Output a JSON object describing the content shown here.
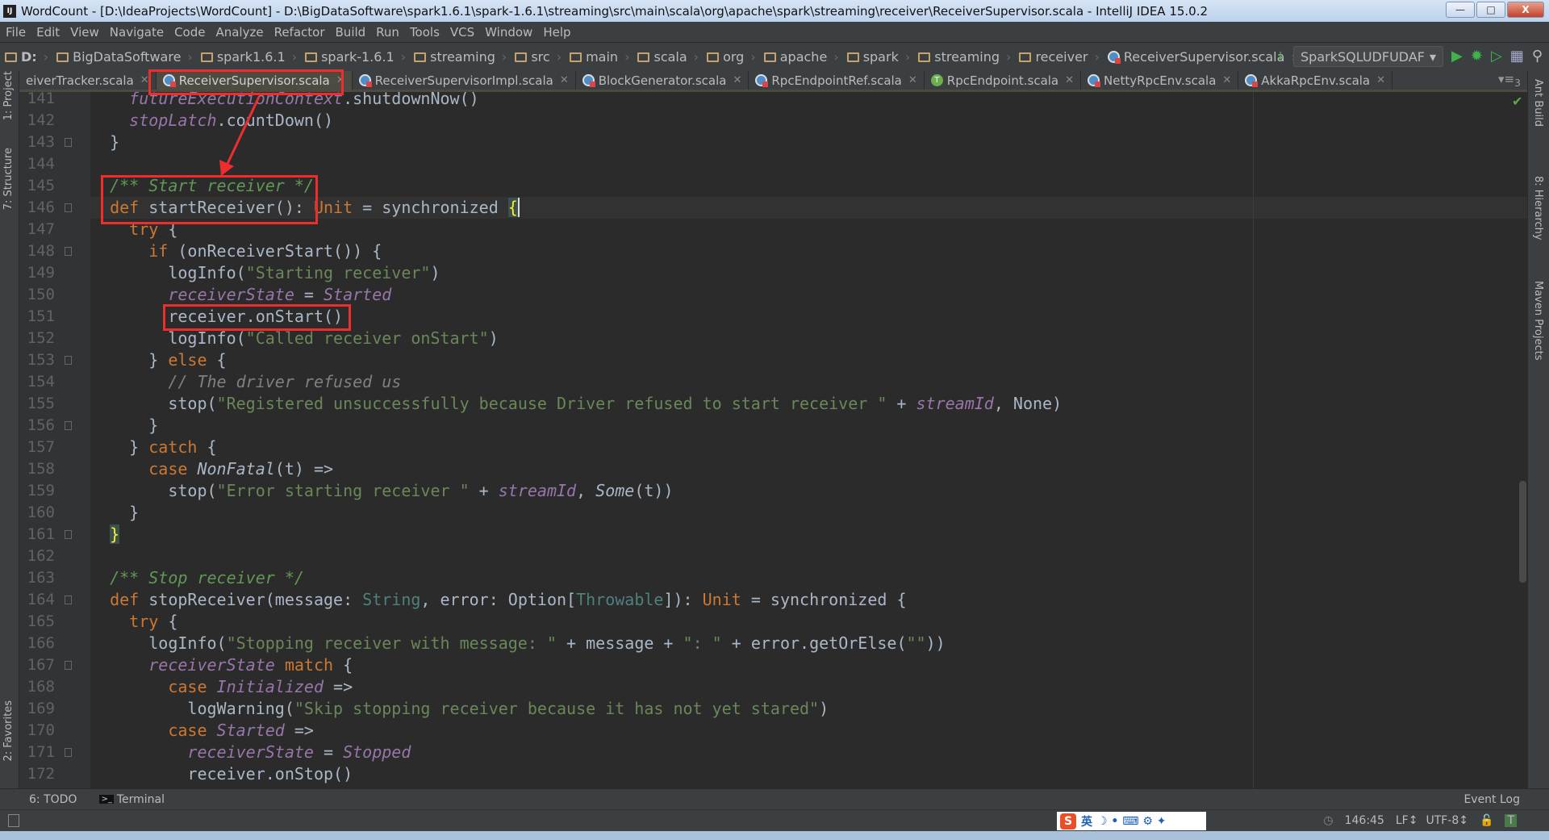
{
  "window": {
    "title": "WordCount - [D:\\IdeaProjects\\WordCount] - D:\\BigDataSoftware\\spark1.6.1\\spark-1.6.1\\streaming\\src\\main\\scala\\org\\apache\\spark\\streaming\\receiver\\ReceiverSupervisor.scala - IntelliJ IDEA 15.0.2",
    "app_icon": "IJ"
  },
  "menu": [
    "File",
    "Edit",
    "View",
    "Navigate",
    "Code",
    "Analyze",
    "Refactor",
    "Build",
    "Run",
    "Tools",
    "VCS",
    "Window",
    "Help"
  ],
  "breadcrumb": [
    "D:",
    "BigDataSoftware",
    "spark1.6.1",
    "spark-1.6.1",
    "streaming",
    "src",
    "main",
    "scala",
    "org",
    "apache",
    "spark",
    "streaming",
    "receiver"
  ],
  "breadcrumb_file": "ReceiverSupervisor.scala",
  "run_config": "SparkSQLUDFUDAF",
  "tabs": [
    {
      "label": "eiverTracker.scala",
      "icon": "scala-class-icon"
    },
    {
      "label": "ReceiverSupervisor.scala",
      "icon": "scala-class-icon",
      "active": true
    },
    {
      "label": "ReceiverSupervisorImpl.scala",
      "icon": "scala-class-icon"
    },
    {
      "label": "BlockGenerator.scala",
      "icon": "scala-class-icon"
    },
    {
      "label": "RpcEndpointRef.scala",
      "icon": "scala-class-icon"
    },
    {
      "label": "RpcEndpoint.scala",
      "icon": "trait-icon"
    },
    {
      "label": "NettyRpcEnv.scala",
      "icon": "scala-class-icon"
    },
    {
      "label": "AkkaRpcEnv.scala",
      "icon": "scala-class-icon"
    }
  ],
  "tab_overflow": "3",
  "left_tools": [
    "1: Project",
    "7: Structure",
    "2: Favorites"
  ],
  "right_tools": [
    "Ant Build",
    "8: Hierarchy",
    "Maven Projects"
  ],
  "current_line": 146,
  "code": [
    {
      "n": "141",
      "t": [
        [
          "pl",
          "    "
        ],
        [
          "fld",
          "futureExecutionContext"
        ],
        [
          "pl",
          ".shutdownNow()"
        ]
      ]
    },
    {
      "n": "142",
      "t": [
        [
          "pl",
          "    "
        ],
        [
          "fld",
          "stopLatch"
        ],
        [
          "pl",
          ".countDown()"
        ]
      ]
    },
    {
      "n": "143",
      "t": [
        [
          "pl",
          "  }"
        ]
      ],
      "fold": true
    },
    {
      "n": "144",
      "t": []
    },
    {
      "n": "145",
      "t": [
        [
          "pl",
          "  "
        ],
        [
          "doc",
          "/** Start receiver */"
        ]
      ]
    },
    {
      "n": "146",
      "t": [
        [
          "pl",
          "  "
        ],
        [
          "kw",
          "def"
        ],
        [
          "pl",
          " startReceiver(): "
        ],
        [
          "kw",
          "Unit"
        ],
        [
          "pl",
          " = synchronized "
        ],
        [
          "brace",
          "{"
        ]
      ],
      "fold": true
    },
    {
      "n": "147",
      "t": [
        [
          "pl",
          "    "
        ],
        [
          "kw",
          "try"
        ],
        [
          "pl",
          " {"
        ]
      ]
    },
    {
      "n": "148",
      "t": [
        [
          "pl",
          "      "
        ],
        [
          "kw",
          "if"
        ],
        [
          "pl",
          " (onReceiverStart()) {"
        ]
      ],
      "fold": true
    },
    {
      "n": "149",
      "t": [
        [
          "pl",
          "        logInfo("
        ],
        [
          "str",
          "\"Starting receiver\""
        ],
        [
          "pl",
          ")"
        ]
      ]
    },
    {
      "n": "150",
      "t": [
        [
          "pl",
          "        "
        ],
        [
          "fld",
          "receiverState"
        ],
        [
          "pl",
          " = "
        ],
        [
          "fld",
          "Started"
        ]
      ]
    },
    {
      "n": "151",
      "t": [
        [
          "pl",
          "        receiver.onStart()"
        ]
      ]
    },
    {
      "n": "152",
      "t": [
        [
          "pl",
          "        logInfo("
        ],
        [
          "str",
          "\"Called receiver onStart\""
        ],
        [
          "pl",
          ")"
        ]
      ]
    },
    {
      "n": "153",
      "t": [
        [
          "pl",
          "      } "
        ],
        [
          "kw",
          "else"
        ],
        [
          "pl",
          " {"
        ]
      ],
      "fold": true
    },
    {
      "n": "154",
      "t": [
        [
          "pl",
          "        "
        ],
        [
          "cmt",
          "// The driver refused us"
        ]
      ]
    },
    {
      "n": "155",
      "t": [
        [
          "pl",
          "        stop("
        ],
        [
          "str",
          "\"Registered unsuccessfully because Driver refused to start receiver \""
        ],
        [
          "pl",
          " + "
        ],
        [
          "fld",
          "streamId"
        ],
        [
          "pl",
          ", None)"
        ]
      ]
    },
    {
      "n": "156",
      "t": [
        [
          "pl",
          "      }"
        ]
      ],
      "fold": true
    },
    {
      "n": "157",
      "t": [
        [
          "pl",
          "    } "
        ],
        [
          "kw",
          "catch"
        ],
        [
          "pl",
          " {"
        ]
      ]
    },
    {
      "n": "158",
      "t": [
        [
          "pl",
          "      "
        ],
        [
          "kw",
          "case"
        ],
        [
          "pl",
          " "
        ],
        [
          "it",
          "NonFatal"
        ],
        [
          "pl",
          "(t) =>"
        ]
      ]
    },
    {
      "n": "159",
      "t": [
        [
          "pl",
          "        stop("
        ],
        [
          "str",
          "\"Error starting receiver \""
        ],
        [
          "pl",
          " + "
        ],
        [
          "fld",
          "streamId"
        ],
        [
          "pl",
          ", "
        ],
        [
          "it",
          "Some"
        ],
        [
          "pl",
          "(t))"
        ]
      ]
    },
    {
      "n": "160",
      "t": [
        [
          "pl",
          "    }"
        ]
      ]
    },
    {
      "n": "161",
      "t": [
        [
          "pl",
          "  "
        ],
        [
          "brace",
          "}"
        ]
      ],
      "fold": true
    },
    {
      "n": "162",
      "t": []
    },
    {
      "n": "163",
      "t": [
        [
          "pl",
          "  "
        ],
        [
          "doc",
          "/** Stop receiver */"
        ]
      ]
    },
    {
      "n": "164",
      "t": [
        [
          "pl",
          "  "
        ],
        [
          "kw",
          "def"
        ],
        [
          "pl",
          " stopReceiver(message: "
        ],
        [
          "type",
          "String"
        ],
        [
          "pl",
          ", error: Option["
        ],
        [
          "type",
          "Throwable"
        ],
        [
          "pl",
          "]): "
        ],
        [
          "kw",
          "Unit"
        ],
        [
          "pl",
          " = synchronized {"
        ]
      ],
      "fold": true
    },
    {
      "n": "165",
      "t": [
        [
          "pl",
          "    "
        ],
        [
          "kw",
          "try"
        ],
        [
          "pl",
          " {"
        ]
      ]
    },
    {
      "n": "166",
      "t": [
        [
          "pl",
          "      logInfo("
        ],
        [
          "str",
          "\"Stopping receiver with message: \""
        ],
        [
          "pl",
          " + message + "
        ],
        [
          "str",
          "\": \""
        ],
        [
          "pl",
          " + error.getOrElse("
        ],
        [
          "str",
          "\"\""
        ],
        [
          "pl",
          "))"
        ]
      ]
    },
    {
      "n": "167",
      "t": [
        [
          "pl",
          "      "
        ],
        [
          "fld",
          "receiverState"
        ],
        [
          "pl",
          " "
        ],
        [
          "kw",
          "match"
        ],
        [
          "pl",
          " {"
        ]
      ],
      "fold": true
    },
    {
      "n": "168",
      "t": [
        [
          "pl",
          "        "
        ],
        [
          "kw",
          "case"
        ],
        [
          "pl",
          " "
        ],
        [
          "fld",
          "Initialized"
        ],
        [
          "pl",
          " =>"
        ]
      ]
    },
    {
      "n": "169",
      "t": [
        [
          "pl",
          "          logWarning("
        ],
        [
          "str",
          "\"Skip stopping receiver because it has not yet stared\""
        ],
        [
          "pl",
          ")"
        ]
      ]
    },
    {
      "n": "170",
      "t": [
        [
          "pl",
          "        "
        ],
        [
          "kw",
          "case"
        ],
        [
          "pl",
          " "
        ],
        [
          "fld",
          "Started"
        ],
        [
          "pl",
          " =>"
        ]
      ]
    },
    {
      "n": "171",
      "t": [
        [
          "pl",
          "          "
        ],
        [
          "fld",
          "receiverState"
        ],
        [
          "pl",
          " = "
        ],
        [
          "fld",
          "Stopped"
        ]
      ],
      "fold": true
    },
    {
      "n": "172",
      "t": [
        [
          "pl",
          "          receiver.onStop()"
        ]
      ]
    }
  ],
  "bottom_tools": {
    "todo": "6: TODO",
    "terminal": "Terminal",
    "event_log": "Event Log"
  },
  "status": {
    "position": "146:45",
    "line_sep": "LF↕",
    "encoding": "UTF-8↕"
  },
  "ime": {
    "logo": "S",
    "mode": "英"
  },
  "colors": {
    "keyword": "#cc7832",
    "string": "#6a8759",
    "field": "#9876aa",
    "annotation_box": "#ee2d2d"
  }
}
